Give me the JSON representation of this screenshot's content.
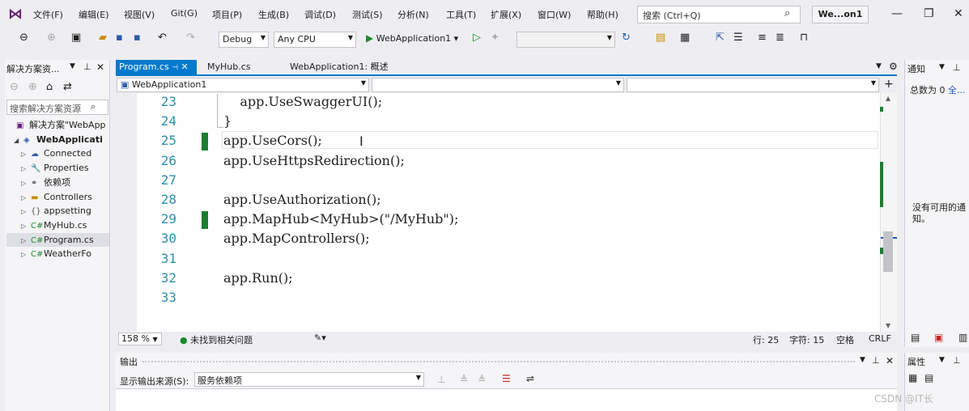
{
  "menu": [
    "文件(F)",
    "编辑(E)",
    "视图(V)",
    "Git(G)",
    "项目(P)",
    "生成(B)",
    "调试(D)",
    "测试(S)",
    "分析(N)",
    "工具(T)",
    "扩展(X)",
    "窗口(W)",
    "帮助(H)"
  ],
  "search": {
    "placeholder": "搜索 (Ctrl+Q)"
  },
  "solution_badge": "We...on1",
  "toolbar": {
    "config": "Debug",
    "platform": "Any CPU",
    "start_label": "WebApplication1"
  },
  "solution_explorer": {
    "title": "解决方案资...",
    "search_placeholder": "搜索解决方案资源",
    "items": [
      {
        "label": "解决方案\"WebApp",
        "indent": 0,
        "icon": "solution-icon"
      },
      {
        "label": "WebApplicati",
        "indent": 1,
        "icon": "project-icon",
        "bold": true
      },
      {
        "label": "Connected",
        "indent": 2,
        "icon": "connected-icon"
      },
      {
        "label": "Properties",
        "indent": 2,
        "icon": "properties-icon"
      },
      {
        "label": "依赖项",
        "indent": 2,
        "icon": "dependencies-icon"
      },
      {
        "label": "Controllers",
        "indent": 2,
        "icon": "folder-icon"
      },
      {
        "label": "appsetting",
        "indent": 2,
        "icon": "json-icon"
      },
      {
        "label": "MyHub.cs",
        "indent": 2,
        "icon": "csharp-icon"
      },
      {
        "label": "Program.cs",
        "indent": 2,
        "icon": "csharp-icon",
        "selected": true
      },
      {
        "label": "WeatherFo",
        "indent": 2,
        "icon": "csharp-icon"
      }
    ]
  },
  "tabs": [
    {
      "label": "Program.cs",
      "active": true
    },
    {
      "label": "MyHub.cs",
      "active": false
    },
    {
      "label": "WebApplication1: 概述",
      "active": false
    }
  ],
  "nav": {
    "project": "WebApplication1",
    "type": "",
    "member": ""
  },
  "code": {
    "lines": [
      {
        "num": "23",
        "text": "    app.UseSwaggerUI();",
        "changed": false
      },
      {
        "num": "24",
        "text": "}",
        "changed": false
      },
      {
        "num": "25",
        "text": "app.UseCors();",
        "changed": true
      },
      {
        "num": "26",
        "text": "app.UseHttpsRedirection();",
        "changed": false
      },
      {
        "num": "27",
        "text": "",
        "changed": false
      },
      {
        "num": "28",
        "text": "app.UseAuthorization();",
        "changed": false
      },
      {
        "num": "29",
        "text": "app.MapHub<MyHub>(\"/MyHub\");",
        "changed": true
      },
      {
        "num": "30",
        "text": "app.MapControllers();",
        "changed": false
      },
      {
        "num": "31",
        "text": "",
        "changed": false
      },
      {
        "num": "32",
        "text": "app.Run();",
        "changed": false
      },
      {
        "num": "33",
        "text": "",
        "changed": false
      }
    ]
  },
  "status": {
    "zoom": "158 %",
    "issues": "未找到相关问题",
    "line": "行: 25",
    "col": "字符: 15",
    "spaces": "空格",
    "eol": "CRLF"
  },
  "output": {
    "title": "输出",
    "source_label": "显示输出来源(S):",
    "source_value": "服务依赖项"
  },
  "notifications": {
    "title": "通知",
    "total": "总数为 0",
    "link": "全...",
    "empty": "没有可用的通知。"
  },
  "properties": {
    "title": "属性"
  },
  "watermark": "CSDN @IT长"
}
